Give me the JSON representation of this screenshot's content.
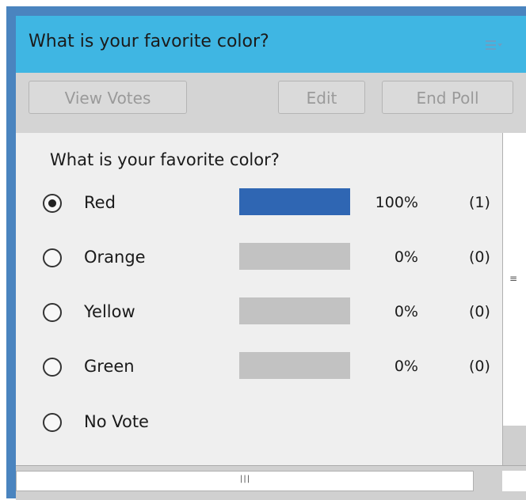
{
  "pod": {
    "title": "What is your favorite color?",
    "menu_icon": "hamburger-dropdown-icon"
  },
  "toolbar": {
    "view_votes_label": "View Votes",
    "edit_label": "Edit",
    "end_poll_label": "End Poll"
  },
  "poll": {
    "question": "What is your favorite color?",
    "options": [
      {
        "label": "Red",
        "selected": true,
        "percent_text": "100%",
        "count_text": "(1)",
        "fraction": 1.0
      },
      {
        "label": "Orange",
        "selected": false,
        "percent_text": "0%",
        "count_text": "(0)",
        "fraction": 0
      },
      {
        "label": "Yellow",
        "selected": false,
        "percent_text": "0%",
        "count_text": "(0)",
        "fraction": 0
      },
      {
        "label": "Green",
        "selected": false,
        "percent_text": "0%",
        "count_text": "(0)",
        "fraction": 0
      },
      {
        "label": "No Vote",
        "selected": false
      }
    ]
  },
  "colors": {
    "titlebar": "#3fb6e3",
    "bar_fill": "#2f66b3",
    "bar_track": "#c2c2c2"
  }
}
